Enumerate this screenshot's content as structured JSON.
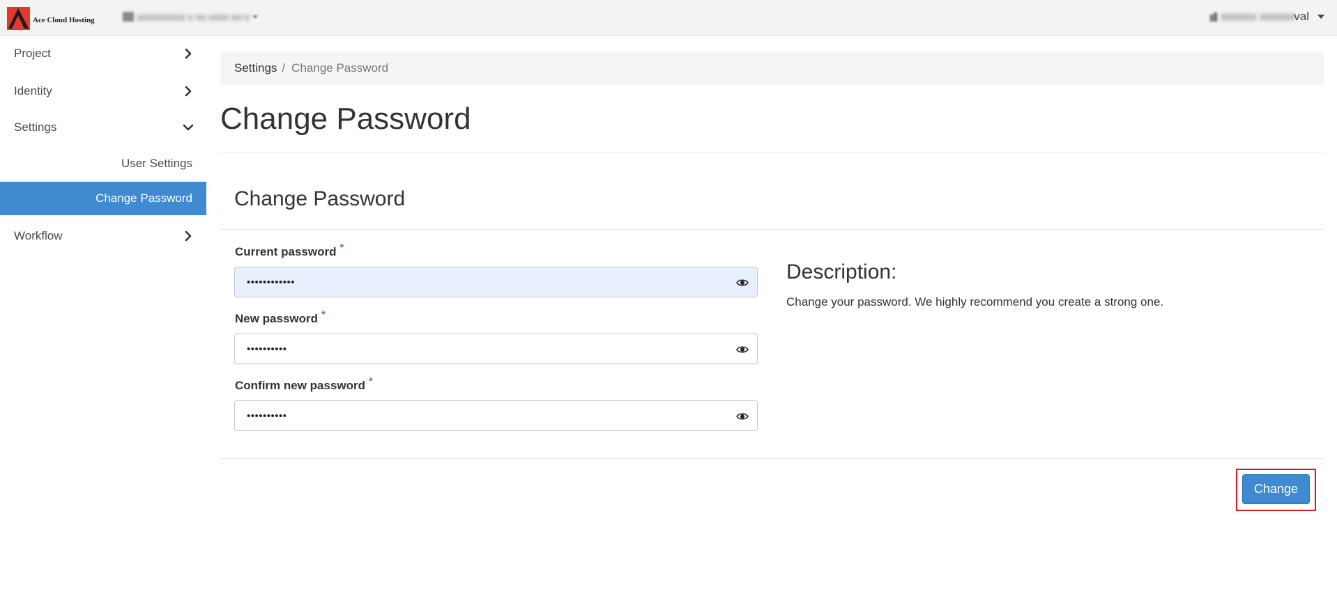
{
  "header": {
    "brand_name": "Ace Cloud Hosting",
    "project_selector": "xxxxxxxxxx x xx-xxxx-xx-x",
    "user_name_blurred": "xxxxxx xxxxxx",
    "user_name_visible": "val"
  },
  "sidebar": {
    "items": [
      {
        "label": "Project",
        "icon": "chevron-right-icon"
      },
      {
        "label": "Identity",
        "icon": "chevron-right-icon"
      },
      {
        "label": "Settings",
        "icon": "chevron-down-icon"
      },
      {
        "label": "Workflow",
        "icon": "chevron-right-icon"
      }
    ],
    "sub_items": [
      {
        "label": "User Settings",
        "active": false
      },
      {
        "label": "Change Password",
        "active": true
      }
    ]
  },
  "breadcrumb": {
    "parent": "Settings",
    "separator": "/",
    "current": "Change Password"
  },
  "page_title": "Change Password",
  "form": {
    "title": "Change Password",
    "fields": [
      {
        "label": "Current password",
        "required": "*",
        "value": "••••••••••••",
        "autofilled": true
      },
      {
        "label": "New password",
        "required": "*",
        "value": "••••••••••"
      },
      {
        "label": "Confirm new password",
        "required": "*",
        "value": "••••••••••"
      }
    ],
    "submit_label": "Change"
  },
  "description": {
    "title": "Description:",
    "text": "Change your password. We highly recommend you create a strong one."
  },
  "colors": {
    "accent": "#3f8ad1",
    "highlight": "#d9161c",
    "autofill_bg": "#e8f0fe",
    "logo_red": "#e03a2c"
  }
}
